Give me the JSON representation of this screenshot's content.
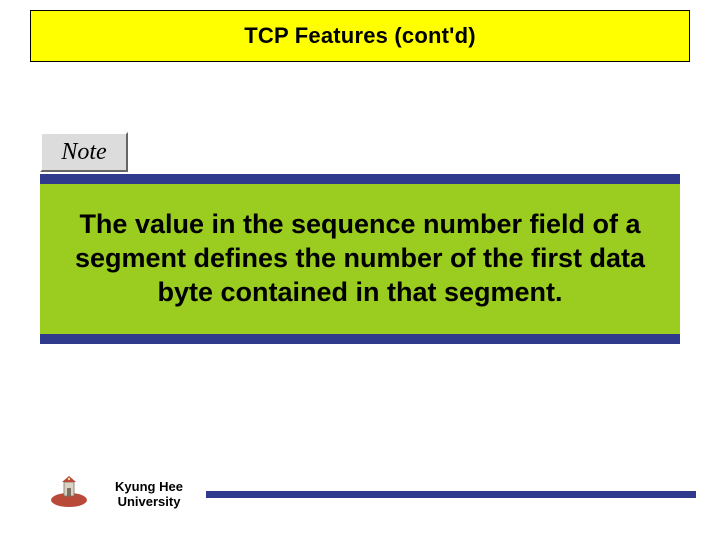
{
  "title": "TCP Features (cont'd)",
  "note_label": "Note",
  "content_text": "The value in the sequence number field of a segment defines the number of the first data byte contained in that segment.",
  "footer": {
    "institution_line1": "Kyung Hee",
    "institution_line2": "University"
  },
  "colors": {
    "banner_bg": "#ffff00",
    "accent": "#2f3a8c",
    "content_bg": "#9acd1f",
    "note_bg": "#dcdcdc"
  }
}
